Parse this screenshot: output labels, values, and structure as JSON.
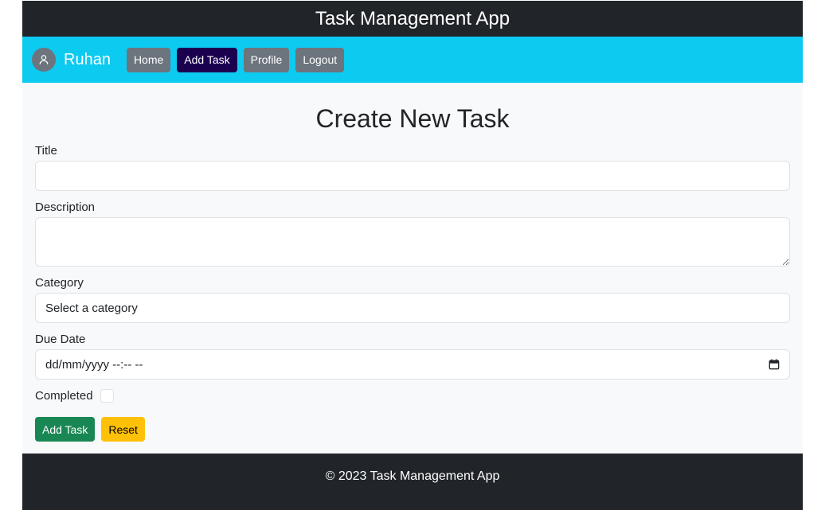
{
  "app": {
    "title": "Task Management App"
  },
  "nav": {
    "username": "Ruhan",
    "avatar_icon": "user-icon",
    "items": [
      {
        "label": "Home",
        "active": false
      },
      {
        "label": "Add Task",
        "active": true
      },
      {
        "label": "Profile",
        "active": false
      },
      {
        "label": "Logout",
        "active": false
      }
    ]
  },
  "form": {
    "title": "Create New Task",
    "fields": {
      "title": {
        "label": "Title",
        "value": ""
      },
      "description": {
        "label": "Description",
        "value": ""
      },
      "category": {
        "label": "Category",
        "selected": "Select a category"
      },
      "due_date": {
        "label": "Due Date",
        "value": "dd/mm/yyyy --:-- --",
        "icon": "calendar-icon"
      },
      "completed": {
        "label": "Completed",
        "checked": false
      }
    },
    "buttons": {
      "submit": "Add Task",
      "reset": "Reset"
    }
  },
  "footer": {
    "text": "© 2023 Task Management App"
  },
  "colors": {
    "header_bg": "#212529",
    "navbar_bg": "#0dcaf0",
    "active_nav": "#1b0050",
    "nav_button": "#6c757d",
    "success": "#198754",
    "warning": "#ffc107"
  }
}
